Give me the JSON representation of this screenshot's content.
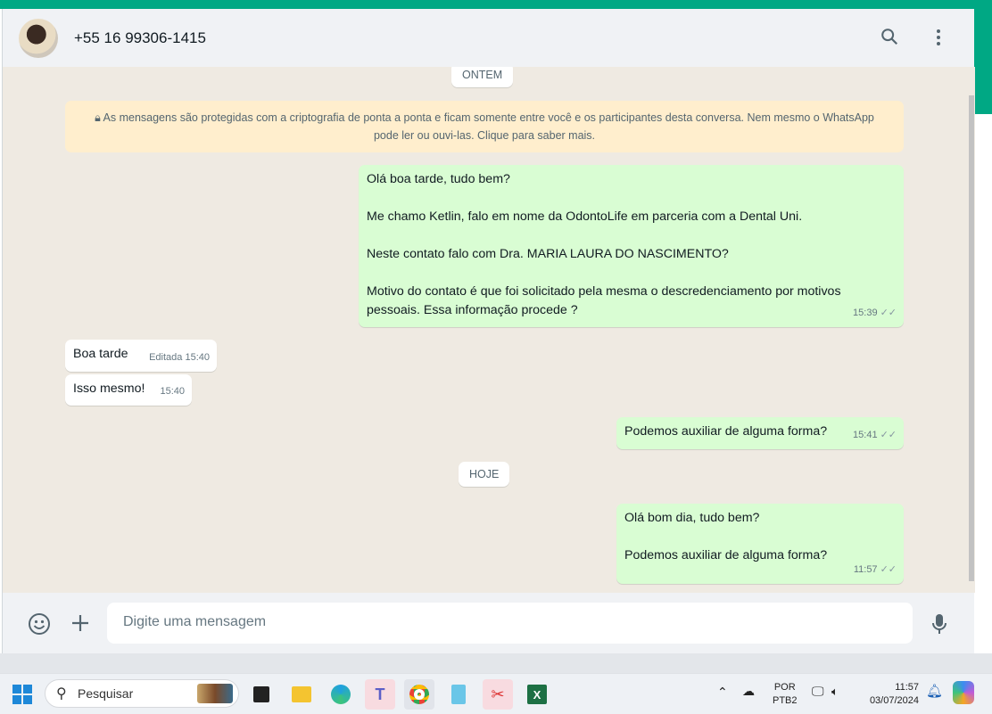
{
  "header": {
    "contact": "+55 16 99306-1415",
    "search_icon": "search-icon",
    "menu_icon": "menu-icon"
  },
  "chat": {
    "date1": "ONTEM",
    "encryption_notice": "As mensagens são protegidas com a criptografia de ponta a ponta e ficam somente entre você e os participantes desta conversa. Nem mesmo o WhatsApp pode ler ou ouvi-las. Clique para saber mais.",
    "messages": [
      {
        "dir": "out",
        "text": "Olá boa tarde, tudo bem?\n\nMe chamo Ketlin, falo em nome da OdontoLife em parceria com a Dental Uni.\n\nNeste contato falo com Dra. MARIA LAURA DO NASCIMENTO?\n\nMotivo do contato é que foi solicitado pela mesma o descredenciamento por motivos pessoais. Essa informação procede ?",
        "time": "15:39"
      },
      {
        "dir": "in",
        "text": "Boa tarde",
        "edited": "Editada",
        "time": "15:40"
      },
      {
        "dir": "in",
        "text": "Isso mesmo!",
        "time": "15:40"
      },
      {
        "dir": "out",
        "text": "Podemos auxiliar de alguma forma?",
        "time": "15:41"
      },
      {
        "dir": "out",
        "text": "Olá bom dia, tudo bem?\n\nPodemos auxiliar de alguma forma?",
        "time": "11:57"
      }
    ],
    "date2": "HOJE"
  },
  "footer": {
    "placeholder": "Digite uma mensagem"
  },
  "taskbar": {
    "search": "Pesquisar",
    "lang1": "POR",
    "lang2": "PTB2",
    "time": "11:57",
    "date": "03/07/2024"
  }
}
